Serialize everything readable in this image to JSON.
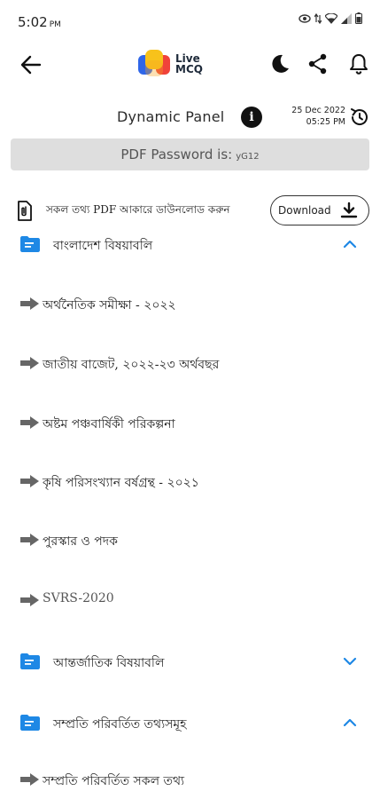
{
  "status": {
    "time": "5:02",
    "ampm": "PM"
  },
  "app": {
    "logo_line1": "Live",
    "logo_line2": "MCQ",
    "colors": {
      "accent": "#1e88e5",
      "logo_yellow": "#f7c21b",
      "logo_blue": "#2f66e8",
      "logo_red": "#f0433a"
    }
  },
  "panel": {
    "title": "Dynamic Panel",
    "date": "25 Dec 2022",
    "time": "05:25 PM"
  },
  "password": {
    "label": "PDF Password is:",
    "value": "yG12"
  },
  "download": {
    "text": "সকল তথ্য PDF আকারে ডাউনলোড করুন",
    "button_label": "Download"
  },
  "sections": [
    {
      "label": "বাংলাদেশ বিষয়াবলি",
      "expanded": true,
      "items": [
        "অর্থনৈতিক সমীক্ষা - ২০২২",
        "জাতীয় বাজেট, ২০২২-২৩ অর্থবছর",
        "অষ্টম পঞ্চবার্ষিকী পরিকল্পনা",
        "কৃষি পরিসংখ্যান বর্ষগ্রন্থ - ২০২১",
        "পুরস্কার ও পদক",
        "SVRS-2020"
      ]
    },
    {
      "label": "আন্তর্জাতিক বিষয়াবলি",
      "expanded": false,
      "items": []
    },
    {
      "label": "সম্প্রতি পরিবর্তিত তথ্যসমূহ",
      "expanded": true,
      "items": [
        "সম্প্রতি পরিবর্তিত সকল তথ্য"
      ]
    }
  ]
}
